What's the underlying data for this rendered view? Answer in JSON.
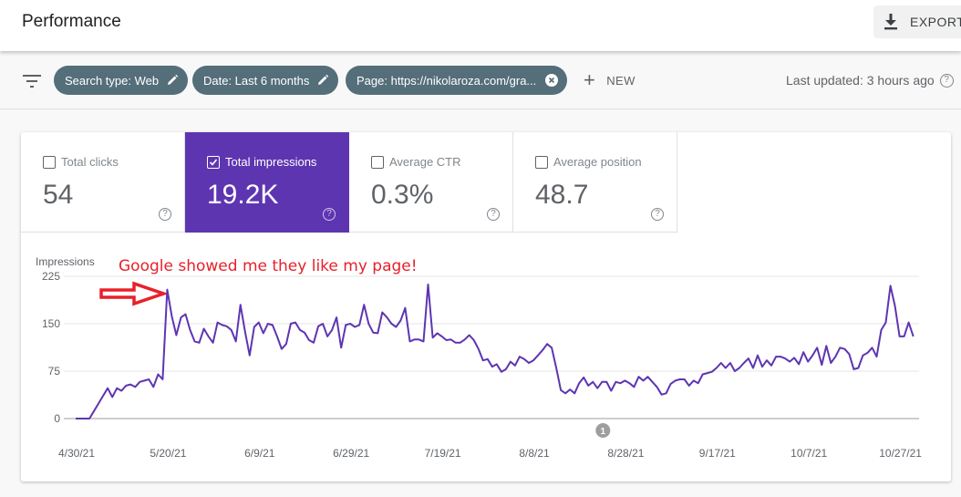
{
  "header": {
    "title": "Performance",
    "export_label": "EXPORT",
    "export_icon": "download-icon"
  },
  "filters": {
    "filter_icon": "filter-list-icon",
    "chips": [
      {
        "label": "Search type: Web",
        "icon": "edit-pencil-icon"
      },
      {
        "label": "Date: Last 6 months",
        "icon": "edit-pencil-icon"
      },
      {
        "label": "Page: https://nikolaroza.com/gra...",
        "icon": "close-circle-icon"
      }
    ],
    "new_label": "NEW",
    "last_updated": "Last updated: 3 hours ago",
    "help_glyph": "?"
  },
  "metrics": [
    {
      "label": "Total clicks",
      "value": "54",
      "checked": false
    },
    {
      "label": "Total impressions",
      "value": "19.2K",
      "checked": true
    },
    {
      "label": "Average CTR",
      "value": "0.3%",
      "checked": false
    },
    {
      "label": "Average position",
      "value": "48.7",
      "checked": false
    }
  ],
  "annotation": {
    "text": "Google showed me they like my page!",
    "color": "#e8202a",
    "points_to_x_index": 20
  },
  "colors": {
    "accent": "#5e35b1",
    "line": "#5e35b1",
    "chip": "#546e7a",
    "annotation": "#e8202a"
  },
  "chart_data": {
    "type": "line",
    "title": "",
    "ylabel": "Impressions",
    "xlabel": "",
    "ylim": [
      0,
      225
    ],
    "yticks": [
      0,
      75,
      150,
      225
    ],
    "x_start": "4/30/21",
    "x_end": "10/29/21",
    "xtick_labels": [
      "4/30/21",
      "5/20/21",
      "6/9/21",
      "6/29/21",
      "7/19/21",
      "8/8/21",
      "8/28/21",
      "9/17/21",
      "10/7/21",
      "10/27/21"
    ],
    "xtick_day_offsets": [
      0,
      20,
      40,
      60,
      80,
      100,
      120,
      140,
      160,
      180
    ],
    "grid": true,
    "event_marker": {
      "label": "1",
      "day_offset": 115
    },
    "series": [
      {
        "name": "Impressions",
        "values": [
          0,
          0,
          0,
          0,
          12,
          24,
          36,
          48,
          34,
          48,
          44,
          52,
          54,
          50,
          58,
          60,
          62,
          50,
          70,
          62,
          204,
          162,
          132,
          160,
          165,
          140,
          122,
          120,
          142,
          130,
          120,
          152,
          148,
          146,
          140,
          122,
          180,
          138,
          100,
          145,
          152,
          135,
          150,
          148,
          130,
          110,
          118,
          150,
          152,
          140,
          136,
          124,
          120,
          146,
          150,
          130,
          140,
          160,
          112,
          148,
          150,
          145,
          148,
          180,
          150,
          136,
          135,
          168,
          160,
          150,
          145,
          155,
          175,
          122,
          125,
          125,
          122,
          212,
          128,
          135,
          130,
          124,
          125,
          120,
          120,
          125,
          132,
          124,
          110,
          92,
          94,
          82,
          86,
          74,
          78,
          90,
          84,
          98,
          94,
          88,
          92,
          100,
          108,
          118,
          112,
          80,
          45,
          40,
          46,
          40,
          56,
          65,
          52,
          58,
          48,
          58,
          58,
          44,
          58,
          56,
          60,
          56,
          50,
          66,
          60,
          66,
          58,
          50,
          38,
          40,
          55,
          60,
          62,
          62,
          52,
          60,
          56,
          70,
          72,
          74,
          80,
          88,
          80,
          88,
          75,
          80,
          88,
          95,
          80,
          100,
          82,
          92,
          84,
          98,
          98,
          95,
          90,
          96,
          86,
          105,
          90,
          100,
          112,
          85,
          115,
          88,
          98,
          112,
          110,
          102,
          78,
          80,
          100,
          104,
          112,
          98,
          140,
          152,
          210,
          178,
          130,
          130,
          152,
          130
        ]
      }
    ]
  }
}
